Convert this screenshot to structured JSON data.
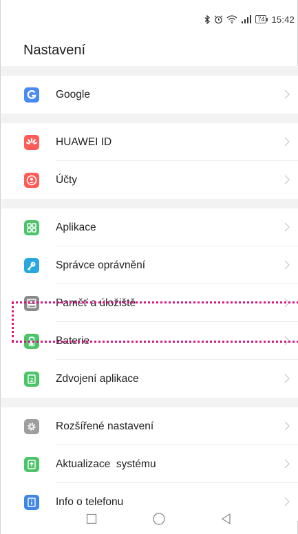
{
  "status_bar": {
    "battery_level": "74",
    "time": "15:42",
    "icons": [
      "bluetooth-icon",
      "alarm-icon",
      "wifi-icon",
      "signal-icon",
      "battery-icon"
    ]
  },
  "header": {
    "title": "Nastavení"
  },
  "sections": [
    {
      "items": [
        {
          "label": "Google",
          "icon": "google-icon",
          "color": "#4a8af4"
        }
      ]
    },
    {
      "items": [
        {
          "label": "HUAWEI ID",
          "icon": "huawei-icon",
          "color": "#ff5b57"
        },
        {
          "label": "Účty",
          "icon": "account-icon",
          "color": "#ff5b57"
        }
      ]
    },
    {
      "items": [
        {
          "label": "Aplikace",
          "icon": "apps-icon",
          "color": "#4cc46a"
        },
        {
          "label": "Správce oprávnění",
          "icon": "key-icon",
          "color": "#29a8e0"
        },
        {
          "label": "Paměť a úložiště",
          "icon": "storage-icon",
          "color": "#8a8a8a"
        },
        {
          "label": "Baterie",
          "icon": "battery-icon",
          "color": "#4cc46a"
        },
        {
          "label": "Zdvojení aplikace",
          "icon": "app-twin-icon",
          "color": "#4cc46a"
        }
      ]
    },
    {
      "items": [
        {
          "label": "Rozšířené nastavení",
          "icon": "gear-icon",
          "color": "#9e9e9e"
        },
        {
          "label": "Aktualizace  systému",
          "icon": "system-update-icon",
          "color": "#4cc46a"
        },
        {
          "label": "Info o telefonu",
          "icon": "info-icon",
          "color": "#3f86e8"
        }
      ]
    }
  ],
  "highlight_color": "#d8147e",
  "nav_bar": [
    "recents-icon",
    "home-icon",
    "back-icon"
  ]
}
